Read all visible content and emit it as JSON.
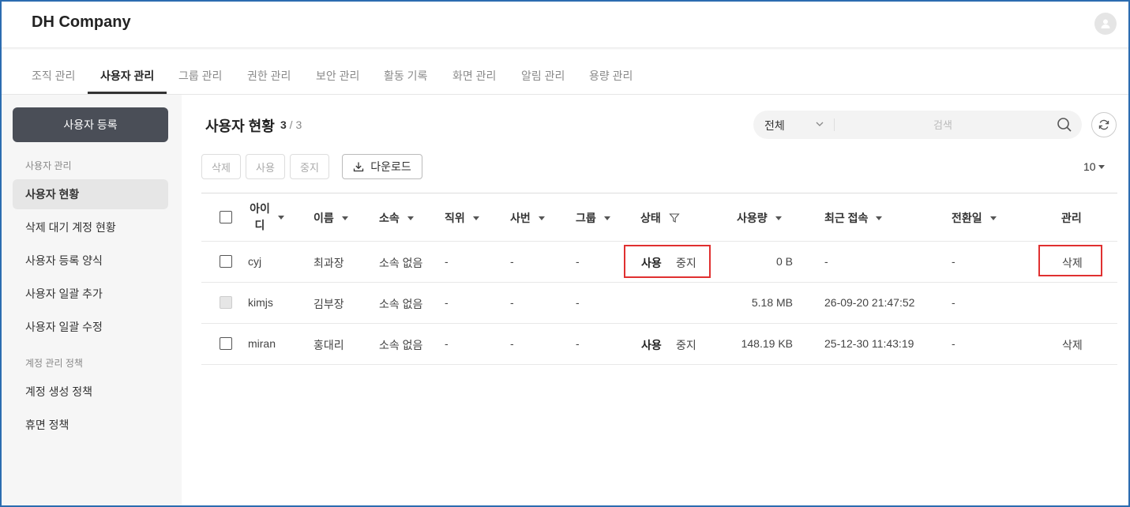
{
  "app": {
    "brand": "DH Company"
  },
  "nav": {
    "tabs": [
      "조직 관리",
      "사용자 관리",
      "그룹 관리",
      "권한 관리",
      "보안 관리",
      "활동 기록",
      "화면 관리",
      "알림 관리",
      "용량 관리"
    ],
    "active_index": 1
  },
  "sidebar": {
    "register_button": "사용자 등록",
    "group1": "사용자 관리",
    "items1": [
      "사용자 현황",
      "삭제 대기 계정 현황",
      "사용자 등록 양식",
      "사용자 일괄 추가",
      "사용자 일괄 수정"
    ],
    "group2": "계정 관리 정책",
    "items2": [
      "계정 생성 정책",
      "휴면 정책"
    ],
    "active_item": "사용자 현황"
  },
  "main": {
    "title": "사용자 현황",
    "count_current": "3",
    "count_sep": " / ",
    "count_total": "3",
    "search": {
      "select_value": "전체",
      "placeholder": "검색"
    },
    "actions": {
      "delete": "삭제",
      "enable": "사용",
      "disable": "중지",
      "download": "다운로드"
    },
    "page_size": "10"
  },
  "table": {
    "headers": {
      "id": "아이디",
      "name": "이름",
      "dept": "소속",
      "position": "직위",
      "emp_no": "사번",
      "group": "그룹",
      "status": "상태",
      "usage": "사용량",
      "last_login": "최근 접속",
      "convert_date": "전환일",
      "manage": "관리"
    },
    "rows": [
      {
        "id": "cyj",
        "name": "최과장",
        "dept": "소속 없음",
        "position": "-",
        "emp_no": "-",
        "group": "-",
        "status_use": "사용",
        "status_stop": "중지",
        "usage": "0 B",
        "last_login": "-",
        "convert_date": "-",
        "manage": "삭제"
      },
      {
        "id": "kimjs",
        "name": "김부장",
        "dept": "소속 없음",
        "position": "-",
        "emp_no": "-",
        "group": "-",
        "status_use": "",
        "status_stop": "",
        "usage": "5.18 MB",
        "last_login": "26-09-20 21:47:52",
        "convert_date": "-",
        "manage": ""
      },
      {
        "id": "miran",
        "name": "홍대리",
        "dept": "소속 없음",
        "position": "-",
        "emp_no": "-",
        "group": "-",
        "status_use": "사용",
        "status_stop": "중지",
        "usage": "148.19 KB",
        "last_login": "25-12-30 11:43:19",
        "convert_date": "-",
        "manage": "삭제"
      }
    ]
  },
  "colors": {
    "accent_dark": "#4a4e57",
    "highlight_red": "#e03030",
    "frame_blue": "#2b6cb0"
  }
}
